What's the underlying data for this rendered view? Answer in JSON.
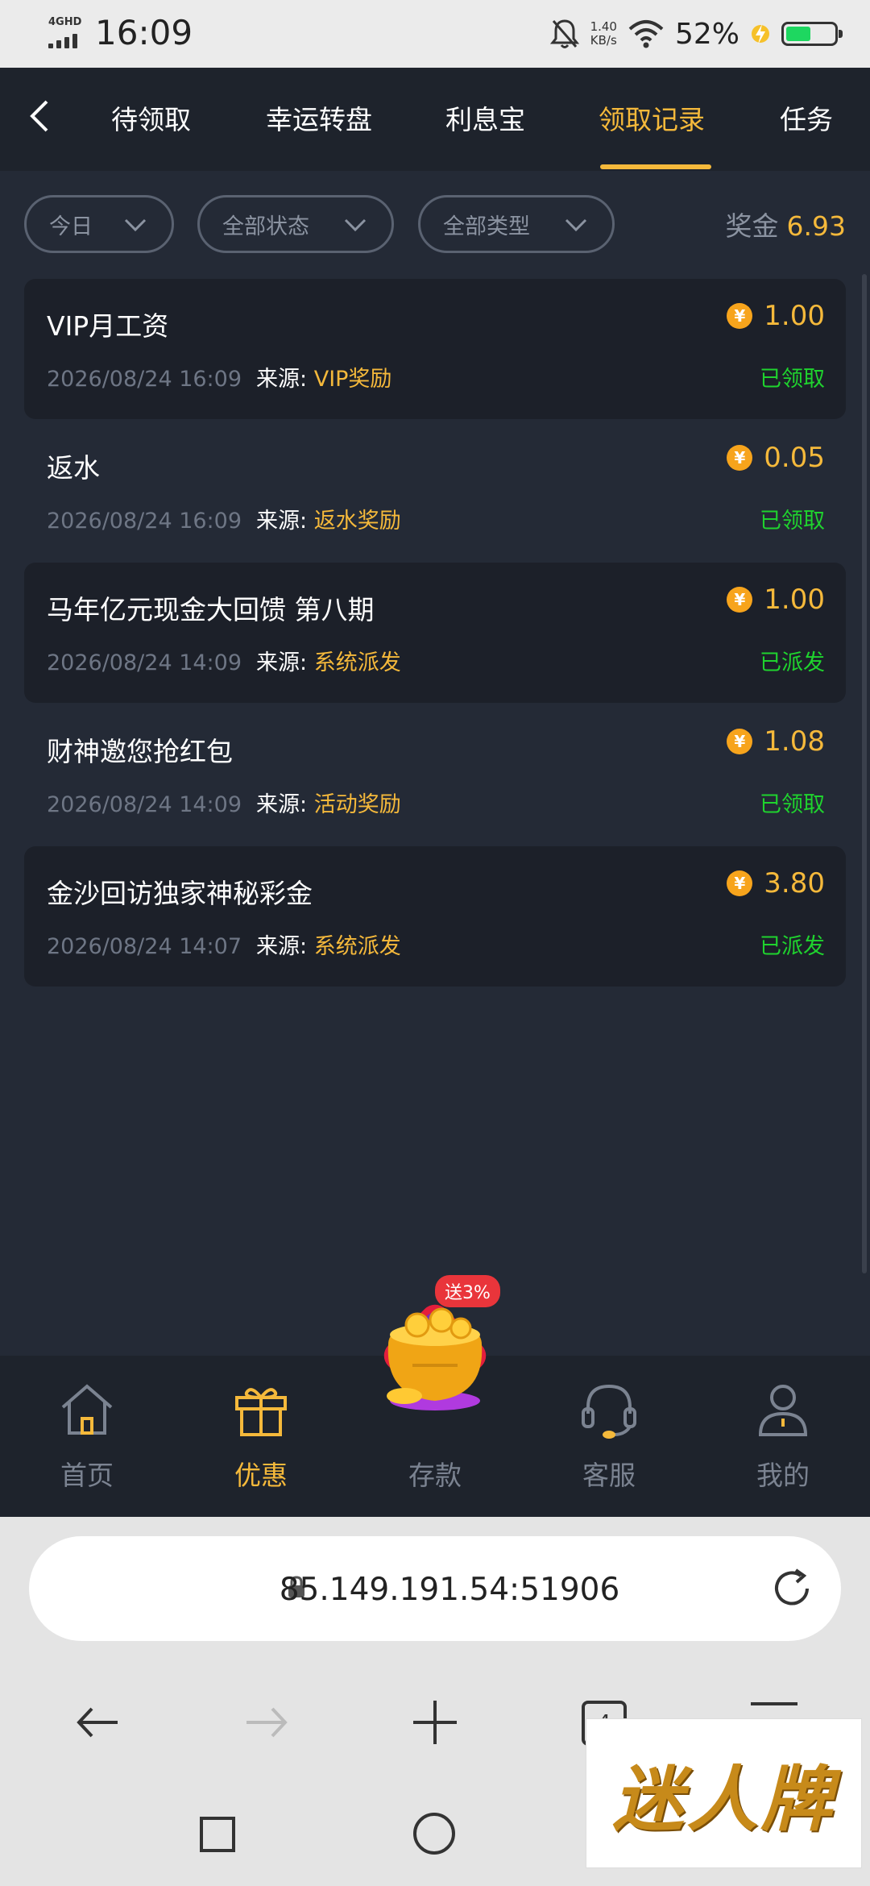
{
  "status_bar": {
    "network": "4GHD",
    "time": "16:09",
    "speed_value": "1.40",
    "speed_unit": "KB/s",
    "battery_percent": "52%",
    "battery_level": 0.52
  },
  "top_nav": {
    "tabs": [
      {
        "label": "待领取"
      },
      {
        "label": "幸运转盘"
      },
      {
        "label": "利息宝"
      },
      {
        "label": "领取记录"
      },
      {
        "label": "任务"
      }
    ],
    "active_tab": "领取记录"
  },
  "filters": {
    "date": "今日",
    "status": "全部状态",
    "type": "全部类型"
  },
  "bonus": {
    "label": "奖金",
    "amount": "6.93"
  },
  "records": [
    {
      "title": "VIP月工资",
      "date": "2026/08/24 16:09",
      "source_label": "来源:",
      "source": "VIP奖励",
      "amount": "1.00",
      "status": "已领取"
    },
    {
      "title": "返水",
      "date": "2026/08/24 16:09",
      "source_label": "来源:",
      "source": "返水奖励",
      "amount": "0.05",
      "status": "已领取"
    },
    {
      "title": "马年亿元现金大回馈 第八期",
      "date": "2026/08/24 14:09",
      "source_label": "来源:",
      "source": "系统派发",
      "amount": "1.00",
      "status": "已派发"
    },
    {
      "title": "财神邀您抢红包",
      "date": "2026/08/24 14:09",
      "source_label": "来源:",
      "source": "活动奖励",
      "amount": "1.08",
      "status": "已领取"
    },
    {
      "title": "金沙回访独家神秘彩金",
      "date": "2026/08/24 14:07",
      "source_label": "来源:",
      "source": "系统派发",
      "amount": "3.80",
      "status": "已派发"
    }
  ],
  "coin_symbol": "¥",
  "bottom_nav": {
    "items": [
      {
        "label": "首页",
        "icon": "home-icon"
      },
      {
        "label": "优惠",
        "icon": "gift-icon"
      },
      {
        "label": "存款",
        "icon": "treasure-pot-icon"
      },
      {
        "label": "客服",
        "icon": "headset-icon"
      },
      {
        "label": "我的",
        "icon": "user-icon"
      }
    ],
    "active": "优惠",
    "deposit_badge": "送3%"
  },
  "browser": {
    "url": "85.149.191.54:51906",
    "tab_count": "4"
  },
  "watermark": "迷人牌",
  "colors": {
    "accent": "#f5b93b",
    "status_green": "#1fd32e",
    "background": "#242a36",
    "nav_bg": "#1e232c",
    "badge_red": "#e9353b"
  }
}
